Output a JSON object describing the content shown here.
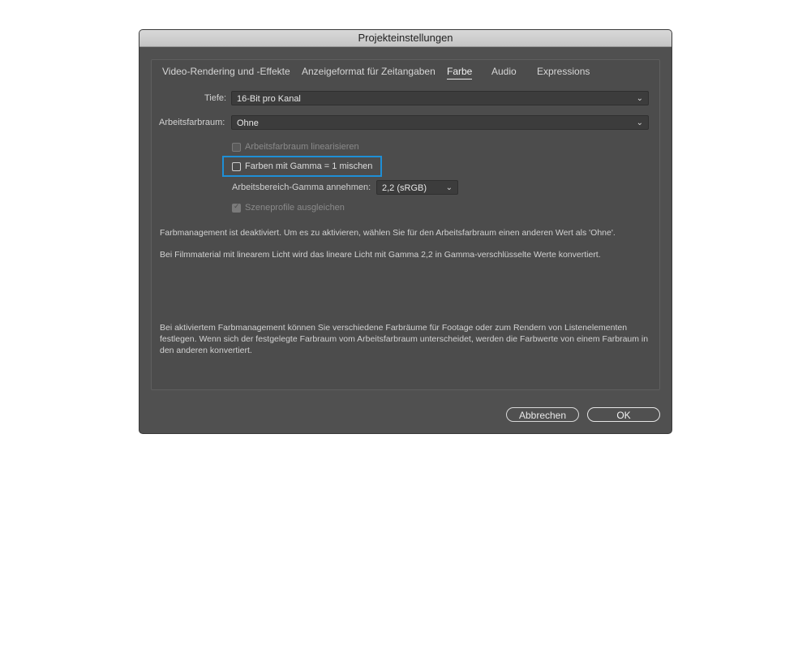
{
  "window": {
    "title": "Projekteinstellungen"
  },
  "tabs": [
    {
      "label": "Video-Rendering und -Effekte",
      "active": false
    },
    {
      "label": "Anzeigeformat für Zeitangaben",
      "active": false
    },
    {
      "label": "Farbe",
      "active": true
    },
    {
      "label": "Audio",
      "active": false
    },
    {
      "label": "Expressions",
      "active": false
    }
  ],
  "depth": {
    "label": "Tiefe:",
    "value": "16-Bit pro Kanal"
  },
  "working_space": {
    "label": "Arbeitsfarbraum:",
    "value": "Ohne"
  },
  "options": {
    "linearize": {
      "label": "Arbeitsfarbraum linearisieren",
      "checked": false,
      "enabled": false
    },
    "blend_gamma": {
      "label": "Farben mit Gamma = 1 mischen",
      "checked": false,
      "enabled": true
    },
    "gamma": {
      "label": "Arbeitsbereich-Gamma annehmen:",
      "value": "2,2 (sRGB)"
    },
    "scene_profiles": {
      "label": "Szeneprofile ausgleichen",
      "checked": true,
      "enabled": false
    }
  },
  "info": {
    "line1": "Farbmanagement ist deaktiviert. Um es zu aktivieren, wählen Sie für den Arbeitsfarbraum einen anderen Wert als 'Ohne'.",
    "line2": "Bei Filmmaterial mit linearem Licht wird das lineare Licht mit Gamma 2,2 in Gamma-verschlüsselte Werte konvertiert.",
    "line3": "Bei aktiviertem Farbmanagement können Sie verschiedene Farbräume für Footage oder zum Rendern von Listenelementen festlegen. Wenn sich der festgelegte Farbraum vom Arbeitsfarbraum unterscheidet, werden die Farbwerte von einem Farbraum in den anderen konvertiert."
  },
  "buttons": {
    "cancel": "Abbrechen",
    "ok": "OK"
  },
  "colors": {
    "dialog_bg": "#505050",
    "highlight": "#1e8fd6",
    "titlebar": "#cfcfcf"
  }
}
